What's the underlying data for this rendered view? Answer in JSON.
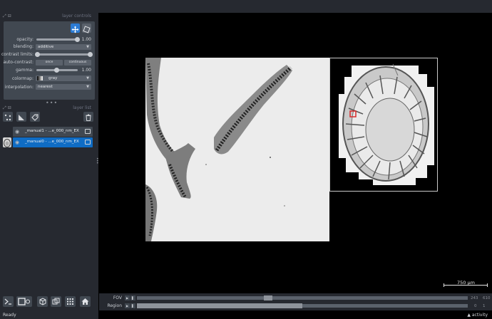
{
  "dock": {
    "layer_controls_title": "layer controls",
    "layer_list_title": "layer list"
  },
  "controls": {
    "opacity": {
      "label": "opacity:",
      "value": "1.00",
      "level": 1.0
    },
    "blending": {
      "label": "blending:",
      "value": "additive"
    },
    "contrast_limits": {
      "label": "contrast limits:"
    },
    "auto_contrast": {
      "label": "auto-contrast:",
      "once": "once",
      "continuous": "continuous"
    },
    "gamma": {
      "label": "gamma:",
      "value": "1.00"
    },
    "colormap": {
      "label": "colormap:",
      "value": "gray"
    },
    "interpolation": {
      "label": "interpolation:",
      "value": "nearest"
    }
  },
  "layers": [
    {
      "name": "_manual1 - ...e_000_nm_EX",
      "selected": false
    },
    {
      "name": "_manual0 - ...e_000_nm_EX",
      "selected": true
    }
  ],
  "status": "Ready",
  "activity": "activity",
  "scale_bar": "750 µm",
  "dims": {
    "fov": {
      "label": "FOV",
      "value": "243",
      "max": "610"
    },
    "region": {
      "label": "Region",
      "value": "0",
      "max": "1"
    }
  },
  "colors": {
    "accent": "#2b7bd4",
    "selected_layer": "#0f6cc4",
    "panel": "#262930"
  }
}
